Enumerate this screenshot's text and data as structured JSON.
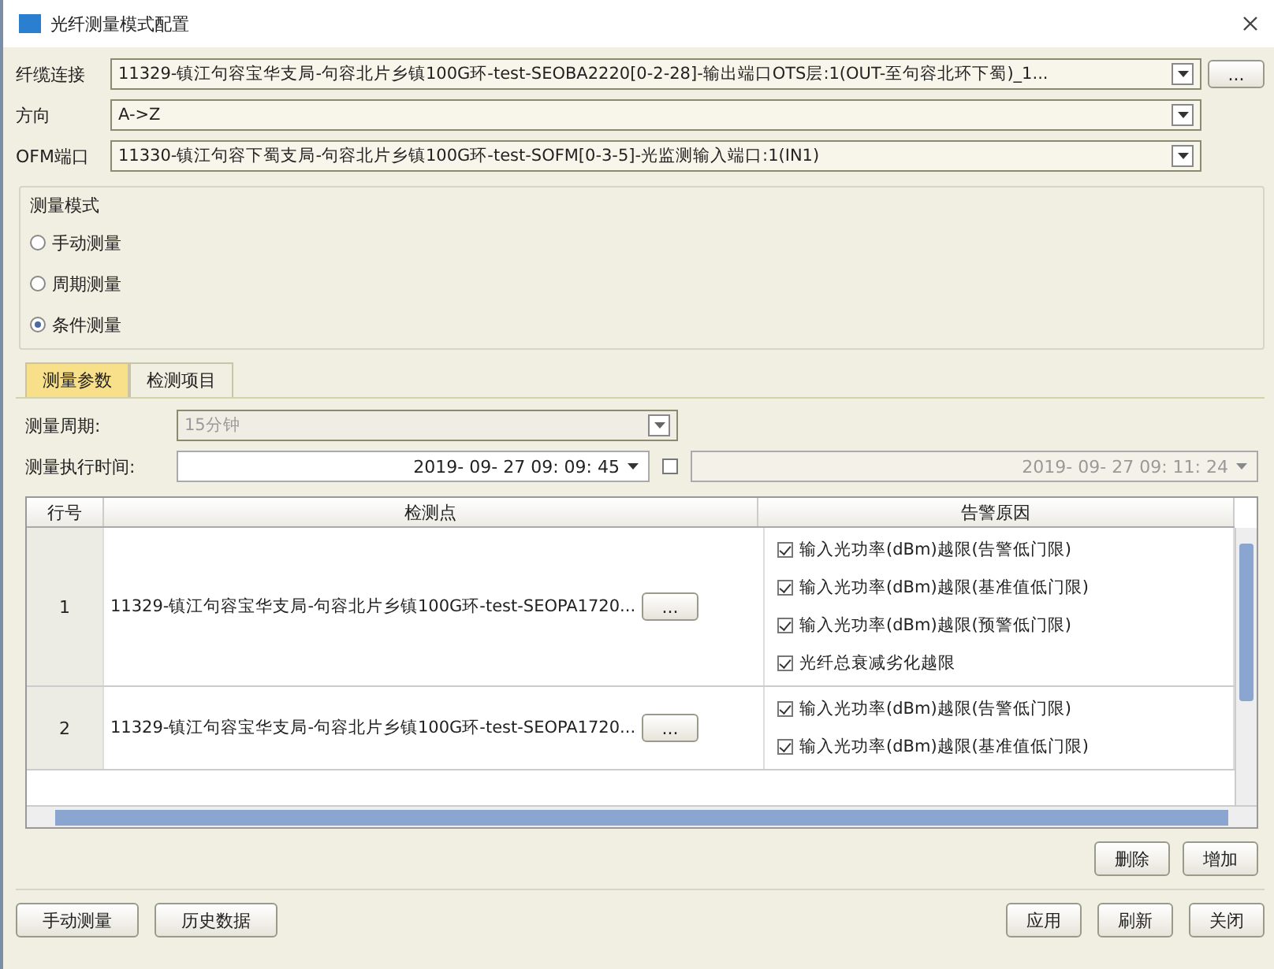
{
  "window": {
    "title": "光纤测量模式配置"
  },
  "fields": [
    {
      "label": "纤缆连接",
      "value": "11329-镇江句容宝华支局-句容北片乡镇100G环-test-SEOBA2220[0-2-28]-输出端口OTS层:1(OUT-至句容北环下蜀)_1...",
      "browse": "..."
    },
    {
      "label": "方向",
      "value": "A->Z"
    },
    {
      "label": "OFM端口",
      "value": "11330-镇江句容下蜀支局-句容北片乡镇100G环-test-SOFM[0-3-5]-光监测输入端口:1(IN1)"
    }
  ],
  "mode": {
    "title": "测量模式",
    "options": [
      {
        "label": "手动测量",
        "selected": false
      },
      {
        "label": "周期测量",
        "selected": false
      },
      {
        "label": "条件测量",
        "selected": true
      }
    ]
  },
  "tabs": [
    {
      "label": "测量参数",
      "selected": true
    },
    {
      "label": "检测项目",
      "selected": false
    }
  ],
  "period": {
    "label": "测量周期:",
    "value": "15分钟",
    "disabled": true
  },
  "exec_time": {
    "label": "测量执行时间:",
    "value": "2019- 09- 27  09: 09: 45",
    "end_checked": false,
    "end_value": "2019- 09- 27  09: 11: 24"
  },
  "table": {
    "columns": [
      "行号",
      "检测点",
      "告警原因"
    ],
    "rows": [
      {
        "number": "1",
        "point": "11329-镇江句容宝华支局-句容北片乡镇100G环-test-SEOPA1720...",
        "button": "...",
        "alarms": [
          {
            "label": "输入光功率(dBm)越限(告警低门限)",
            "checked": true
          },
          {
            "label": "输入光功率(dBm)越限(基准值低门限)",
            "checked": true
          },
          {
            "label": "输入光功率(dBm)越限(预警低门限)",
            "checked": true
          },
          {
            "label": "光纤总衰减劣化越限",
            "checked": true
          }
        ]
      },
      {
        "number": "2",
        "point": "11329-镇江句容宝华支局-句容北片乡镇100G环-test-SEOPA1720...",
        "button": "...",
        "alarms": [
          {
            "label": "输入光功率(dBm)越限(告警低门限)",
            "checked": true
          },
          {
            "label": "输入光功率(dBm)越限(基准值低门限)",
            "checked": true
          }
        ]
      }
    ]
  },
  "table_buttons": [
    "删除",
    "增加"
  ],
  "footer_left": [
    "手动测量",
    "历史数据"
  ],
  "footer_right": [
    "应用",
    "刷新",
    "关闭"
  ]
}
